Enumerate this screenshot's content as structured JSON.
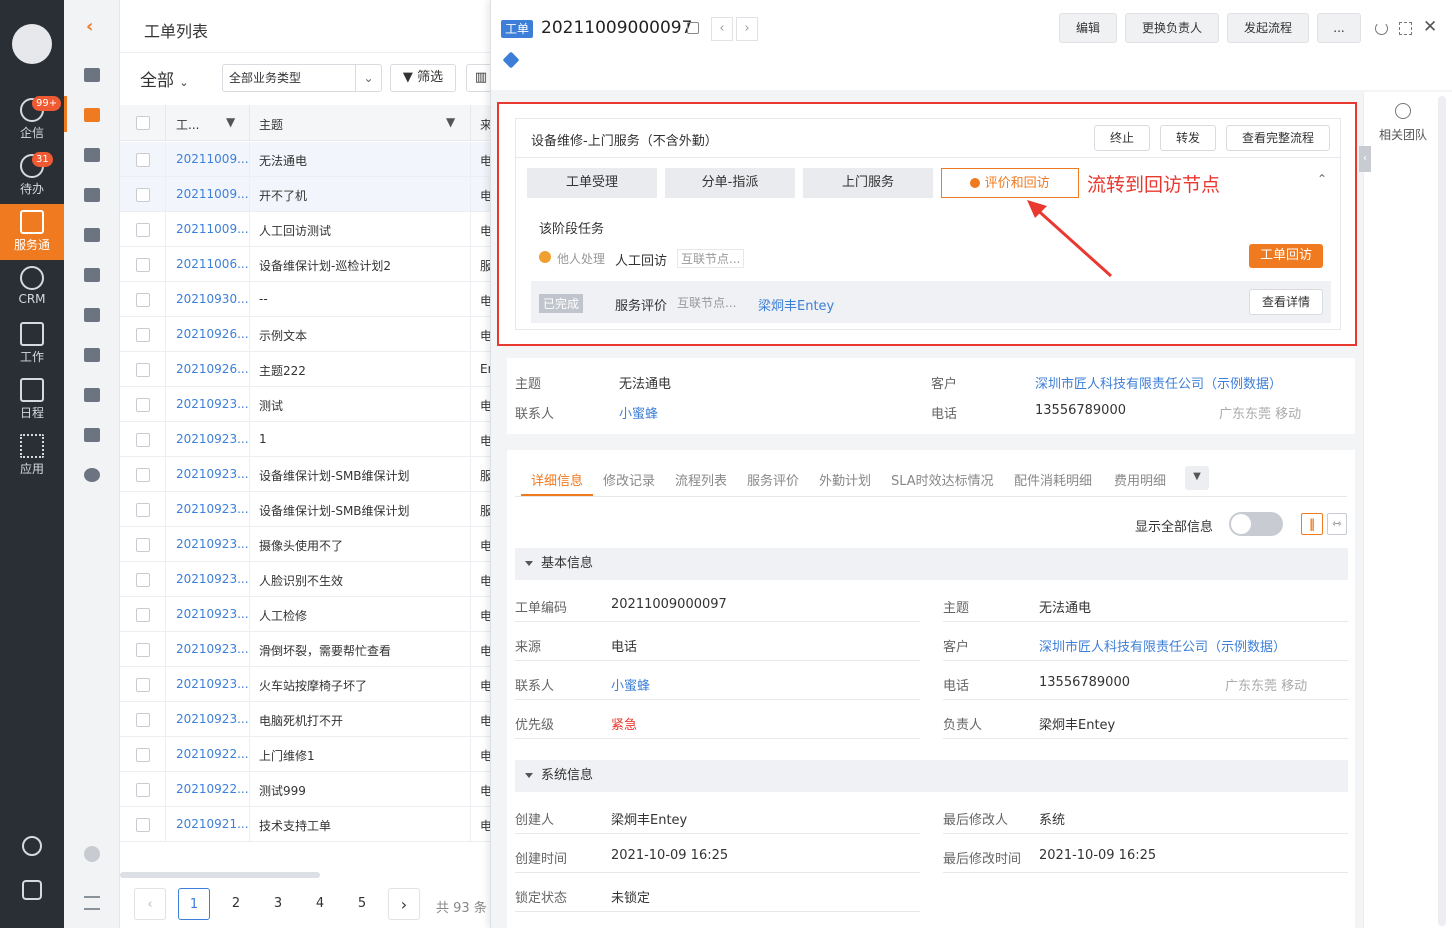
{
  "nav": {
    "items": [
      {
        "label": "企信",
        "badge": "99+"
      },
      {
        "label": "待办",
        "badge": "31"
      },
      {
        "label": "服务通",
        "badge": ""
      },
      {
        "label": "CRM",
        "badge": ""
      },
      {
        "label": "工作",
        "badge": ""
      },
      {
        "label": "日程",
        "badge": ""
      },
      {
        "label": "应用",
        "badge": ""
      }
    ]
  },
  "list": {
    "title": "工单列表",
    "filter_scope": "全部",
    "biz_type": "全部业务类型",
    "filter_label": "筛选",
    "col_code": "工...",
    "col_subject": "主题",
    "col_source": "来",
    "rows": [
      {
        "code": "20211009...",
        "subject": "无法通电",
        "src": "电"
      },
      {
        "code": "20211009...",
        "subject": "开不了机",
        "src": "电"
      },
      {
        "code": "20211009...",
        "subject": "人工回访测试",
        "src": "电"
      },
      {
        "code": "20211006...",
        "subject": "设备维保计划-巡检计划2",
        "src": "服"
      },
      {
        "code": "20210930...",
        "subject": "--",
        "src": "电"
      },
      {
        "code": "20210926...",
        "subject": "示例文本",
        "src": "电"
      },
      {
        "code": "20210926...",
        "subject": "主题222",
        "src": "Er"
      },
      {
        "code": "20210923...",
        "subject": "测试",
        "src": "电"
      },
      {
        "code": "20210923...",
        "subject": "1",
        "src": "电"
      },
      {
        "code": "20210923...",
        "subject": "设备维保计划-SMB维保计划",
        "src": "服"
      },
      {
        "code": "20210923...",
        "subject": "设备维保计划-SMB维保计划",
        "src": "服"
      },
      {
        "code": "20210923...",
        "subject": "摄像头使用不了",
        "src": "电"
      },
      {
        "code": "20210923...",
        "subject": "人脸识别不生效",
        "src": "电"
      },
      {
        "code": "20210923...",
        "subject": "人工检修",
        "src": "电"
      },
      {
        "code": "20210923...",
        "subject": "滑倒坏裂，需要帮忙查看",
        "src": "电"
      },
      {
        "code": "20210923...",
        "subject": "火车站按摩椅子坏了",
        "src": "电"
      },
      {
        "code": "20210923...",
        "subject": "电脑死机打不开",
        "src": "电"
      },
      {
        "code": "20210922...",
        "subject": "上门维修1",
        "src": "电"
      },
      {
        "code": "20210922...",
        "subject": "测试999",
        "src": "电"
      },
      {
        "code": "20210921...",
        "subject": "技术支持工单",
        "src": "电"
      }
    ],
    "pages": [
      "1",
      "2",
      "3",
      "4",
      "5"
    ],
    "total": "共 93 条"
  },
  "detail": {
    "tag": "工单",
    "code": "20211009000097",
    "edit": "编辑",
    "change_owner": "更换负责人",
    "start_flow": "发起流程",
    "more": "...",
    "related_team": "相关团队",
    "flow": {
      "title": "设备维修-上门服务（不含外勤）",
      "terminate": "终止",
      "forward": "转发",
      "view_full": "查看完整流程",
      "stages": [
        "工单受理",
        "分单-指派",
        "上门服务",
        "评价和回访"
      ],
      "annotation": "流转到回访节点",
      "tasks_title": "该阶段任务",
      "task1_status": "他人处理",
      "task1_name": "人工回访",
      "task1_node": "互联节点...",
      "task1_btn": "工单回访",
      "task2_status": "已完成",
      "task2_name": "服务评价",
      "task2_node": "互联节点...",
      "task2_person": "梁炯丰Entey",
      "task2_btn": "查看详情"
    },
    "summary": {
      "subject_label": "主题",
      "subject": "无法通电",
      "contact_label": "联系人",
      "contact": "小蜜蜂",
      "customer_label": "客户",
      "customer": "深圳市匠人科技有限责任公司（示例数据）",
      "phone_label": "电话",
      "phone": "13556789000",
      "phone_loc": "广东东莞 移动"
    },
    "tabs": [
      "详细信息",
      "修改记录",
      "流程列表",
      "服务评价",
      "外勤计划",
      "SLA时效达标情况",
      "配件消耗明细",
      "费用明细"
    ],
    "show_all": "显示全部信息",
    "basic": {
      "title": "基本信息",
      "code_label": "工单编码",
      "code": "20211009000097",
      "subject_label": "主题",
      "subject": "无法通电",
      "source_label": "来源",
      "source": "电话",
      "customer_label": "客户",
      "customer": "深圳市匠人科技有限责任公司（示例数据）",
      "contact_label": "联系人",
      "contact": "小蜜蜂",
      "phone_label": "电话",
      "phone": "13556789000",
      "phone_loc": "广东东莞 移动",
      "priority_label": "优先级",
      "priority": "紧急",
      "owner_label": "负责人",
      "owner": "梁炯丰Entey"
    },
    "system": {
      "title": "系统信息",
      "creator_label": "创建人",
      "creator": "梁炯丰Entey",
      "modifier_label": "最后修改人",
      "modifier": "系统",
      "created_label": "创建时间",
      "created": "2021-10-09 16:25",
      "modified_label": "最后修改时间",
      "modified": "2021-10-09 16:25",
      "lock_label": "锁定状态",
      "lock": "未锁定"
    }
  },
  "colors": {
    "accent": "#f07a1f",
    "link": "#3d7fd8",
    "nav_bg": "#2a2f36",
    "highlight": "#e8382f",
    "urgent": "#e8382f"
  }
}
